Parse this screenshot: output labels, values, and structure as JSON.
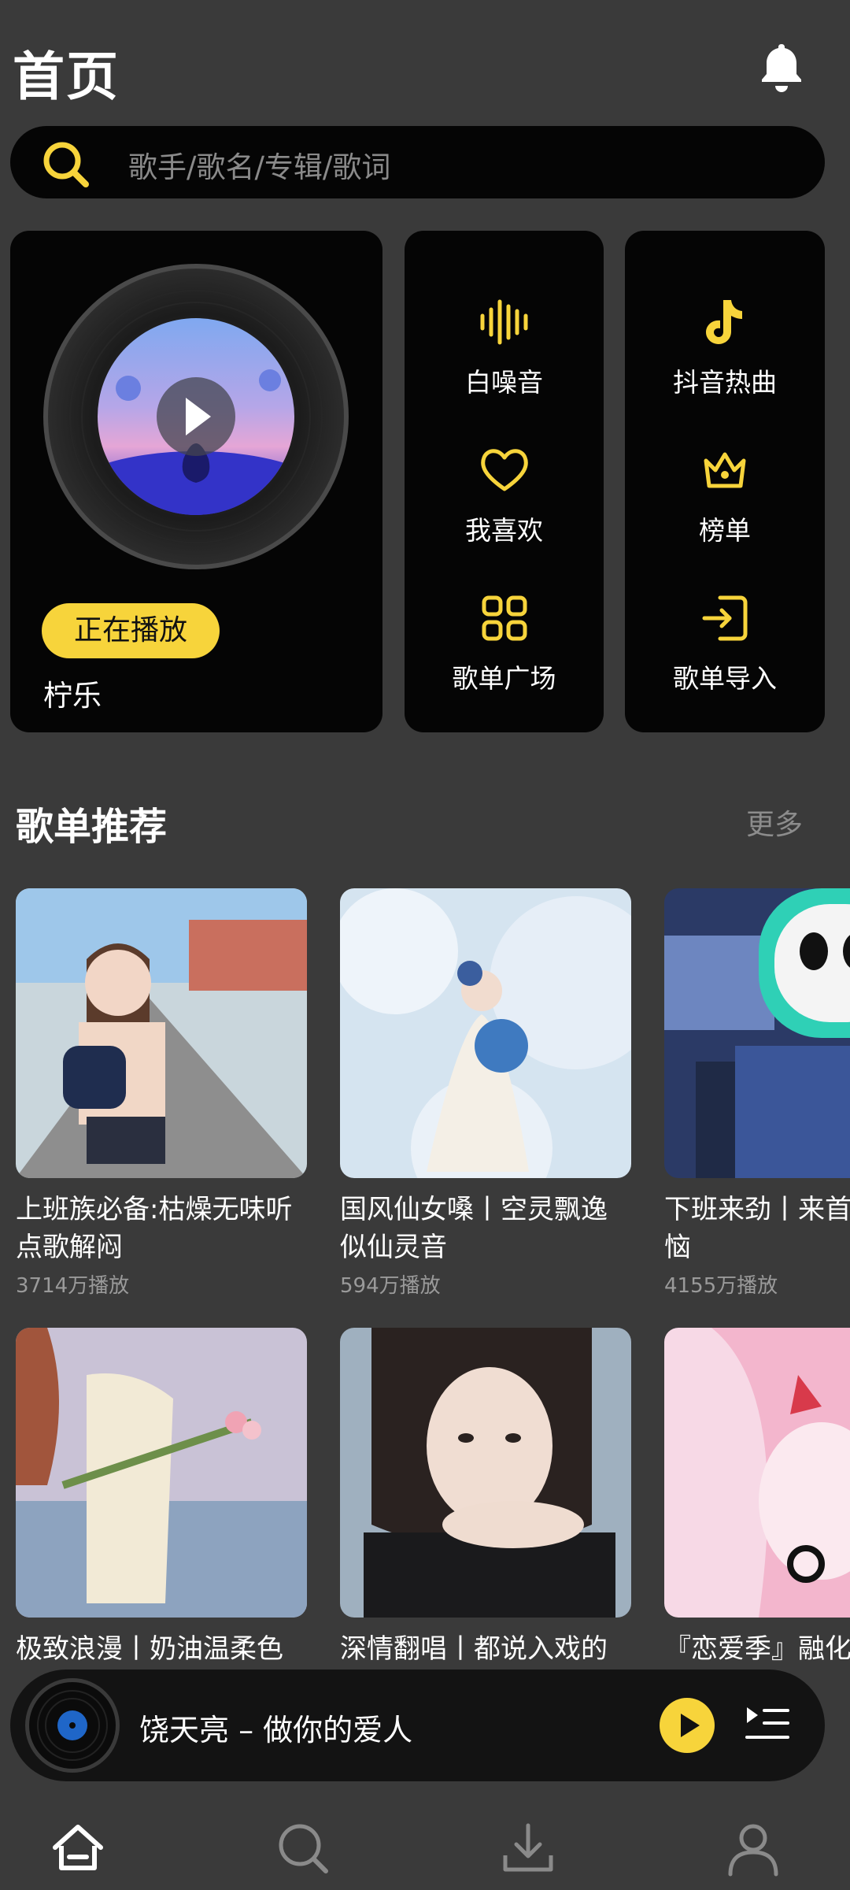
{
  "header": {
    "title": "首页"
  },
  "search": {
    "placeholder": "歌手/歌名/专辑/歌词"
  },
  "now_playing": {
    "badge": "正在播放",
    "title": "柠乐"
  },
  "shortcuts": [
    {
      "label": "白噪音",
      "icon": "soundwave-icon"
    },
    {
      "label": "我喜欢",
      "icon": "heart-icon"
    },
    {
      "label": "歌单广场",
      "icon": "grid-icon"
    },
    {
      "label": "抖音热曲",
      "icon": "music-note-icon"
    },
    {
      "label": "榜单",
      "icon": "crown-icon"
    },
    {
      "label": "歌单导入",
      "icon": "import-icon"
    }
  ],
  "section": {
    "title": "歌单推荐",
    "more": "更多"
  },
  "playlists": [
    {
      "title": "上班族必备:枯燥无味听点歌解闷",
      "plays": "3714万播放"
    },
    {
      "title": "国风仙女嗓丨空灵飘逸似仙灵音",
      "plays": "594万播放"
    },
    {
      "title": "下班来劲丨来首抛开烦恼",
      "plays": "4155万播放"
    },
    {
      "title": "极致浪漫丨奶油温柔色调",
      "plays": ""
    },
    {
      "title": "深情翻唱丨都说入戏的人最深情",
      "plays": ""
    },
    {
      "title": "『恋爱季』融化的甜甜恋音",
      "plays": ""
    }
  ],
  "mini_player": {
    "title": "饶天亮 – 做你的爱人"
  },
  "colors": {
    "accent": "#f7d43b",
    "background": "#3a3a3a",
    "card": "#050505"
  }
}
